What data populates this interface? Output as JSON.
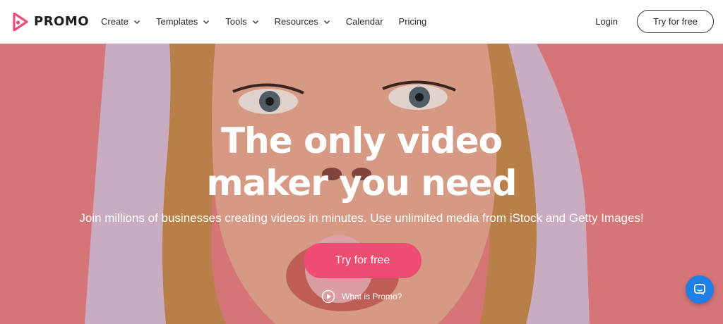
{
  "brand": {
    "name": "PROMO",
    "logo_icon": "promo-play-logo-icon",
    "accent": "#ee4c73"
  },
  "nav": {
    "items": [
      {
        "label": "Create",
        "dropdown": true
      },
      {
        "label": "Templates",
        "dropdown": true
      },
      {
        "label": "Tools",
        "dropdown": true
      },
      {
        "label": "Resources",
        "dropdown": true
      },
      {
        "label": "Calendar",
        "dropdown": false
      },
      {
        "label": "Pricing",
        "dropdown": false
      }
    ],
    "login_label": "Login",
    "cta_label": "Try for free"
  },
  "hero": {
    "title_line1": "The only video",
    "title_line2": "maker you need",
    "subtitle": "Join millions of businesses creating videos in minutes. Use unlimited media from iStock and Getty Images!",
    "cta_label": "Try for free",
    "secondary_link": "What is Promo?",
    "background_color": "#e87f82",
    "cta_color": "#ee4c73"
  },
  "chat": {
    "icon": "chat-bubble-icon",
    "color": "#1f7fe6"
  }
}
